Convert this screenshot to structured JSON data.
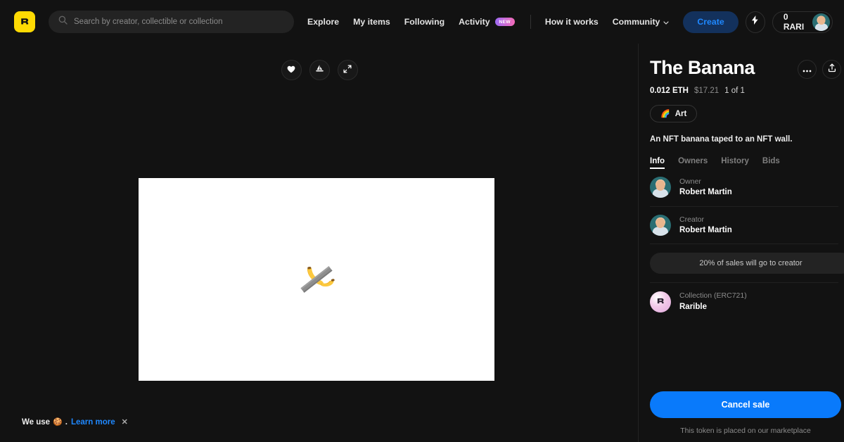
{
  "header": {
    "logo_icon": "rarible-logo-icon",
    "search": {
      "icon": "search-icon",
      "placeholder": "Search by creator, collectible or collection",
      "value": ""
    },
    "nav": [
      {
        "label": "Explore",
        "icon": null,
        "badge": null
      },
      {
        "label": "My items",
        "icon": null,
        "badge": null
      },
      {
        "label": "Following",
        "icon": null,
        "badge": null
      },
      {
        "label": "Activity",
        "icon": null,
        "badge": "NEW"
      },
      {
        "label": "How it works",
        "icon": null,
        "badge": null
      },
      {
        "label": "Community",
        "icon": "chevron-down-icon",
        "badge": null
      }
    ],
    "create_label": "Create",
    "bolt_icon": "lightning-bolt-icon",
    "balance_label": "0 RARI",
    "avatar_icon": "user-avatar"
  },
  "artwork": {
    "actions": [
      {
        "name": "like-button",
        "icon": "heart-icon"
      },
      {
        "name": "opensea-button",
        "icon": "opensea-sailboat-icon"
      },
      {
        "name": "fullscreen-button",
        "icon": "expand-arrows-icon"
      }
    ],
    "image_alt": "banana taped to a wall",
    "background": "#ffffff"
  },
  "cookie_banner": {
    "text_before": "We use",
    "emoji": "🍪",
    "separator": ".",
    "link_label": "Learn more",
    "close_icon": "close-icon"
  },
  "sidebar": {
    "title": "The Banana",
    "title_actions": [
      {
        "name": "more-options-button",
        "icon": "ellipsis-icon"
      },
      {
        "name": "share-button",
        "icon": "share-upload-icon"
      }
    ],
    "price_eth": "0.012 ETH",
    "price_usd": "$17.21",
    "edition": "1 of 1",
    "tag": {
      "emoji": "🌈",
      "label": "Art"
    },
    "description": "An NFT banana taped to an NFT wall.",
    "tabs": [
      {
        "label": "Info",
        "active": true
      },
      {
        "label": "Owners",
        "active": false
      },
      {
        "label": "History",
        "active": false
      },
      {
        "label": "Bids",
        "active": false
      }
    ],
    "owner": {
      "role": "Owner",
      "name": "Robert Martin"
    },
    "creator": {
      "role": "Creator",
      "name": "Robert Martin"
    },
    "royalty": "20% of sales will go to creator",
    "collection": {
      "role": "Collection (ERC721)",
      "name": "Rarible"
    },
    "cta_label": "Cancel sale",
    "cta_note": "This token is placed on our marketplace"
  },
  "colors": {
    "background": "#121212",
    "accent_blue": "#097AFB",
    "brand_yellow": "#FEDA03",
    "create_blue_text": "#1f88ff",
    "muted_text": "#8c8c8c"
  }
}
